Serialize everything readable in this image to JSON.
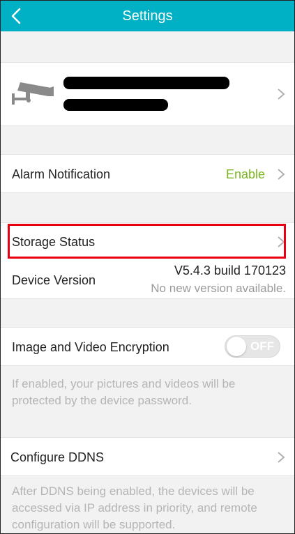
{
  "header": {
    "title": "Settings",
    "back_icon": "chevron-left-icon"
  },
  "device": {
    "icon": "camera-icon",
    "name_redacted": true,
    "id_redacted": true
  },
  "alarm": {
    "label": "Alarm Notification",
    "value": "Enable"
  },
  "storage": {
    "label": "Storage Status"
  },
  "version": {
    "label": "Device Version",
    "value": "V5.4.3 build 170123",
    "status": "No new version available."
  },
  "encryption": {
    "label": "Image and Video Encryption",
    "toggle": "OFF",
    "note": "If enabled, your pictures and videos will be protected by the device password."
  },
  "ddns": {
    "label": "Configure DDNS",
    "note": "After DDNS being enabled, the devices will be accessed via IP address in priority, and remote configuration will be supported."
  },
  "colors": {
    "header": "#00b0c4",
    "enable": "#7ab51d",
    "highlight": "#e60012"
  }
}
